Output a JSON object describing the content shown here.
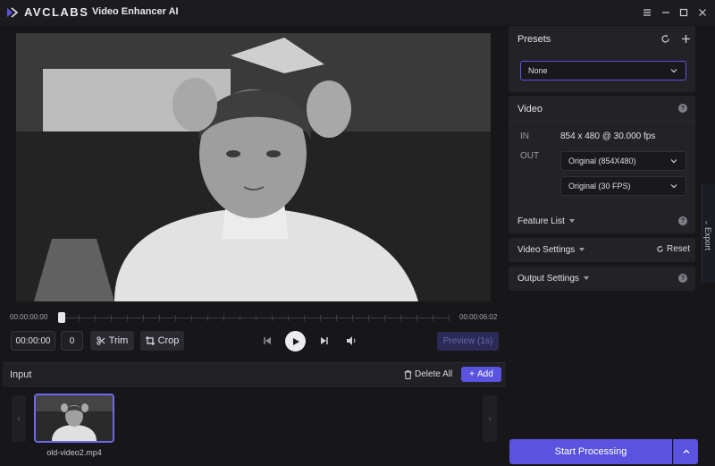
{
  "app": {
    "brand": "AVCLABS",
    "product": "Video Enhancer AI"
  },
  "window_controls": [
    "menu-icon",
    "minimize-icon",
    "maximize-icon",
    "close-icon"
  ],
  "timeline": {
    "start_time": "00:00:00:00",
    "end_time": "00:00:06:02",
    "playhead_fraction": 0
  },
  "controls": {
    "time_value": "00:00:00",
    "frame_value": "0",
    "trim_label": "Trim",
    "crop_label": "Crop",
    "preview_label": "Preview (1s)"
  },
  "input": {
    "title": "Input",
    "delete_all_label": "Delete All",
    "add_label": "Add",
    "files": [
      {
        "name": "old-video2.mp4"
      }
    ]
  },
  "presets": {
    "title": "Presets",
    "selected": "None"
  },
  "video": {
    "title": "Video",
    "in_label": "IN",
    "in_value": "854 x 480 @ 30.000 fps",
    "out_label": "OUT",
    "out_resolution": "Original (854X480)",
    "out_fps": "Original (30 FPS)"
  },
  "sections": {
    "feature_list": "Feature List",
    "video_settings": "Video Settings",
    "reset_label": "Reset",
    "output_settings": "Output Settings"
  },
  "export_label": "Export",
  "start_label": "Start Processing",
  "colors": {
    "accent": "#5a53e0",
    "panel": "#222227",
    "background": "#17171a"
  }
}
